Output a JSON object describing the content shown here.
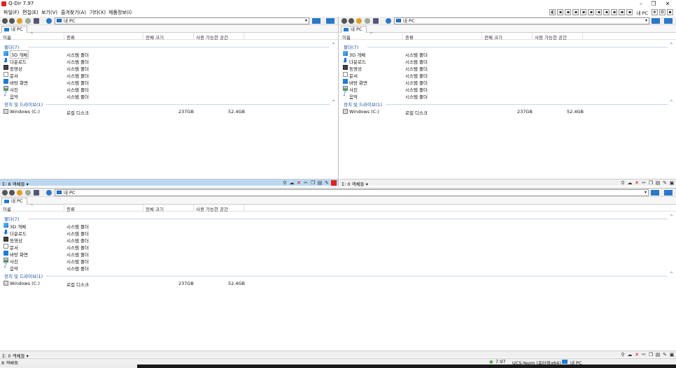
{
  "window": {
    "title": "Q-Dir 7.97"
  },
  "menu": [
    "파일(F)",
    "편집(E)",
    "보기(V)",
    "즐겨찾기(A)",
    "기타(X)",
    "제품정보(I)"
  ],
  "menu_right_pc": "내 PC",
  "colors": {
    "accent": "#1e7bd4",
    "status_active": "#bcd8f0",
    "group_text": "#1b4f9b"
  },
  "columns": [
    "이름",
    "종류",
    "전체 크기",
    "사용 가능한 공간"
  ],
  "groups": {
    "folders": "폴더(7)",
    "devices": "장치 및 드라이브(1)"
  },
  "folders": [
    {
      "name": "3D 개체",
      "type": "시스템 폴더",
      "icon": "cube-icon"
    },
    {
      "name": "다운로드",
      "type": "시스템 폴더",
      "icon": "download-icon"
    },
    {
      "name": "동영상",
      "type": "시스템 폴더",
      "icon": "video-icon"
    },
    {
      "name": "문서",
      "type": "시스템 폴더",
      "icon": "document-icon"
    },
    {
      "name": "바탕 화면",
      "type": "시스템 폴더",
      "icon": "desktop-icon"
    },
    {
      "name": "사진",
      "type": "시스템 폴더",
      "icon": "picture-icon"
    },
    {
      "name": "음악",
      "type": "시스템 폴더",
      "icon": "music-icon"
    }
  ],
  "drive": {
    "name": "Windows (C:)",
    "type": "로컬 디스크",
    "total": "237GB",
    "free": "52.4GB",
    "icon": "drive-icon"
  },
  "panes": [
    {
      "address": "내 PC",
      "tab": "내 PC",
      "status": "8 객체들 ▾"
    },
    {
      "address": "내 PC",
      "tab": "내 PC",
      "status": "0 객체들 ▾"
    },
    {
      "address": "내 PC",
      "tab": "내 PC",
      "status": "0 객체들 ▾"
    }
  ],
  "status_prefix": "Σ:",
  "bottombar": {
    "left": "8 객체들",
    "version": "7.97",
    "user": "UCS-Yeom (포터블x64)",
    "location": "내 PC"
  }
}
